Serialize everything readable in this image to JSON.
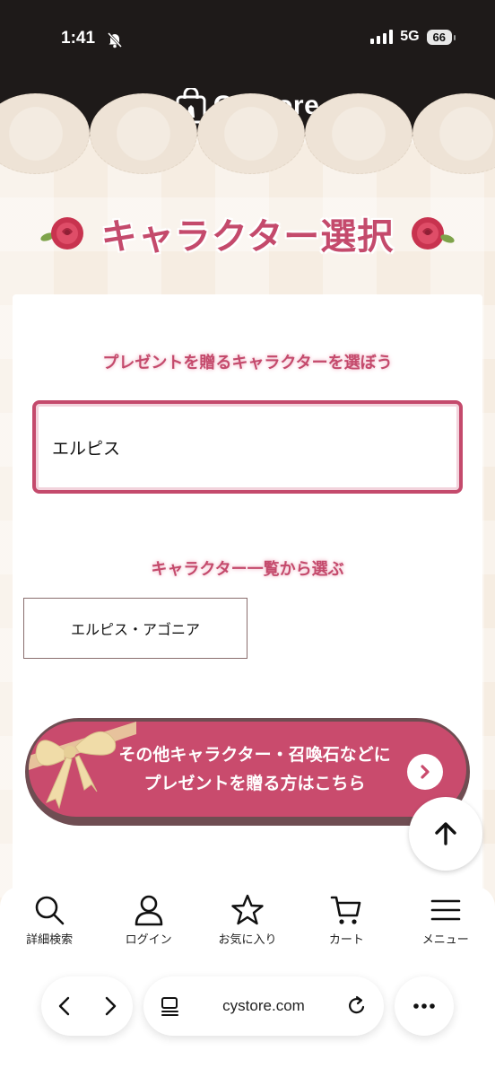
{
  "status": {
    "time": "1:41",
    "network": "5G",
    "battery": "66"
  },
  "header": {
    "brand": "CyStore"
  },
  "page": {
    "title": "キャラクター選択",
    "select_heading": "プレゼントを贈るキャラクターを選ぼう",
    "search_value": "エルピス",
    "list_heading": "キャラクター一覧から選ぶ",
    "characters": [
      "エルピス・アゴニア"
    ],
    "cta_line1": "その他キャラクター・召喚石などに",
    "cta_line2": "プレゼントを贈る方はこちら"
  },
  "bottom_nav": {
    "items": [
      {
        "label": "詳細検索",
        "icon": "search-icon"
      },
      {
        "label": "ログイン",
        "icon": "user-icon"
      },
      {
        "label": "お気に入り",
        "icon": "star-icon"
      },
      {
        "label": "カート",
        "icon": "cart-icon"
      },
      {
        "label": "メニュー",
        "icon": "menu-icon"
      }
    ]
  },
  "browser": {
    "url": "cystore.com"
  },
  "colors": {
    "accent": "#c44a6c",
    "header_bg": "#1e1a19",
    "page_bg": "#f6ede2"
  }
}
